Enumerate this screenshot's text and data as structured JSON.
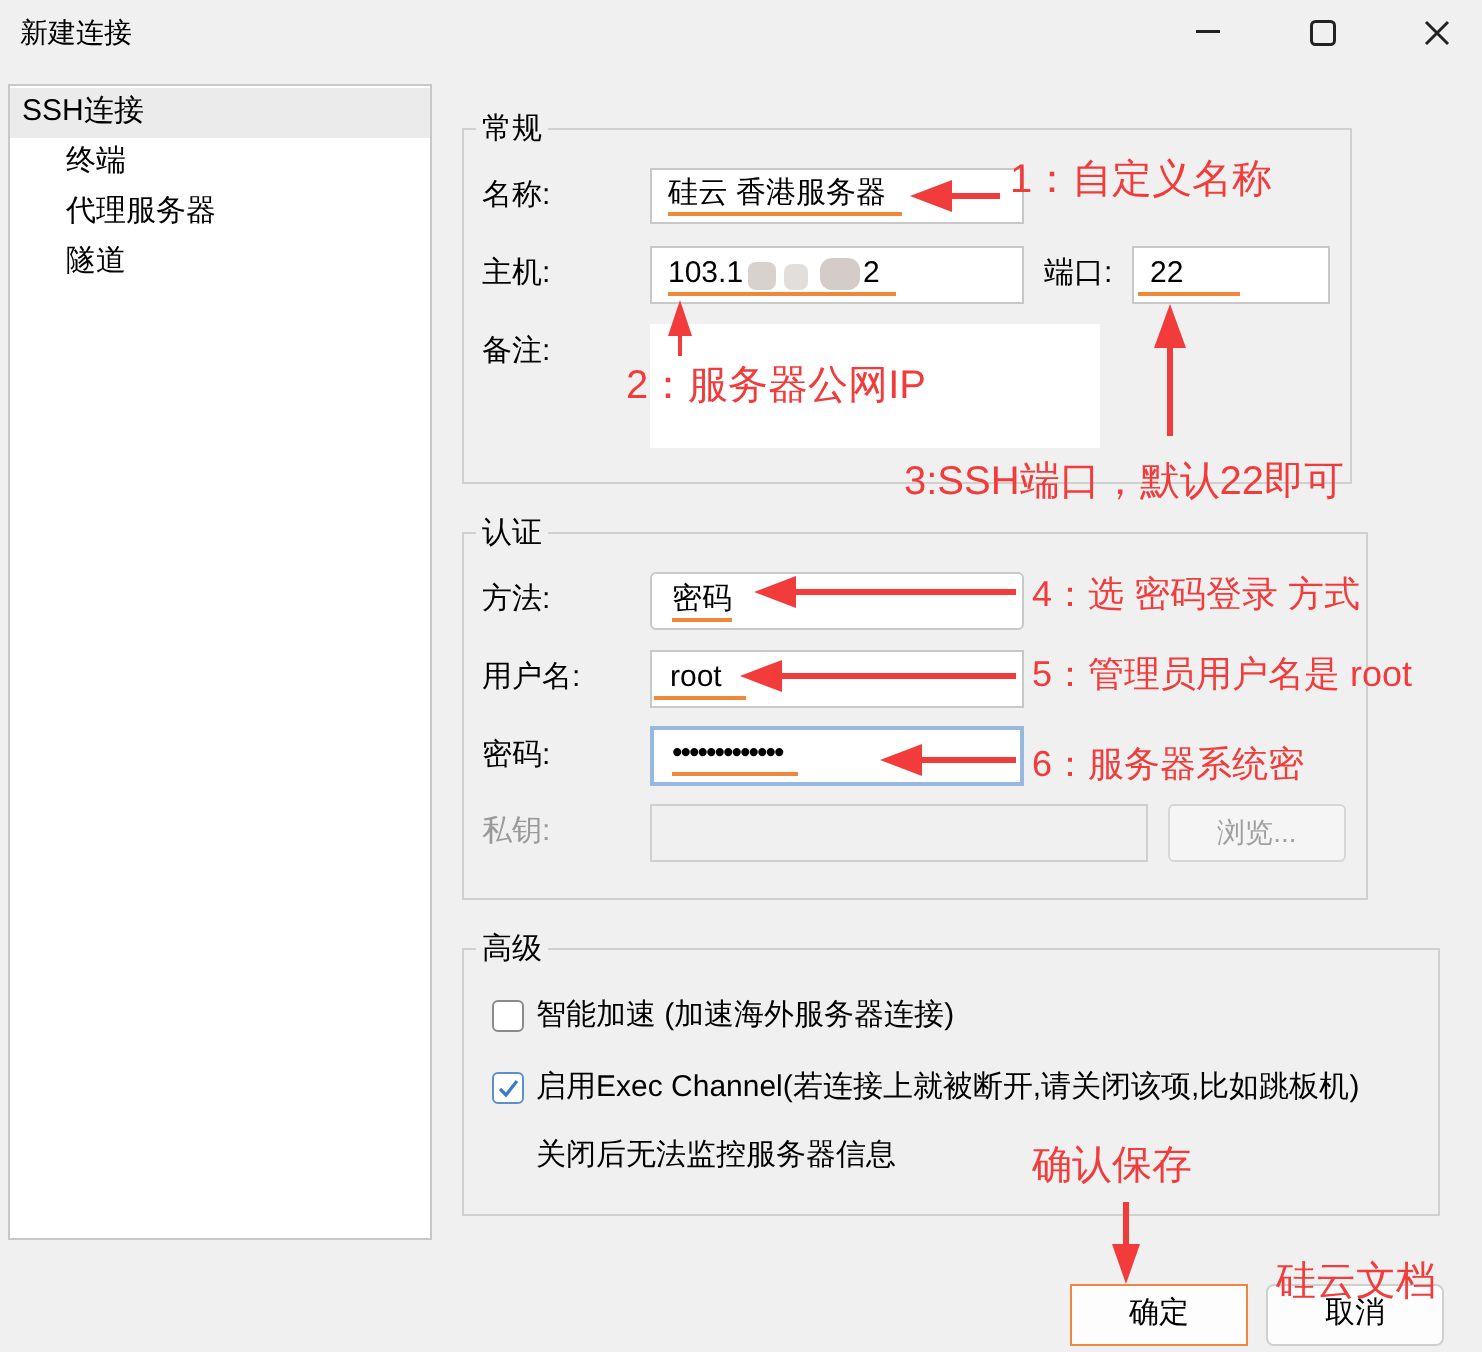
{
  "window": {
    "title": "新建连接"
  },
  "sidebar": {
    "items": [
      {
        "label": "SSH连接",
        "selected": true,
        "children": [
          {
            "label": "终端",
            "selected": false
          },
          {
            "label": "代理服务器",
            "selected": false
          },
          {
            "label": "隧道",
            "selected": false
          }
        ]
      }
    ]
  },
  "general": {
    "title": "常规",
    "name": {
      "label": "名称:",
      "value": "硅云 香港服务器"
    },
    "host": {
      "label": "主机:",
      "value_start": "103.1",
      "value_end": "2"
    },
    "port": {
      "label": "端口:",
      "value": "22"
    },
    "note": {
      "label": "备注:"
    }
  },
  "auth": {
    "title": "认证",
    "method": {
      "label": "方法:",
      "value": "密码"
    },
    "user": {
      "label": "用户名:",
      "value": "root"
    },
    "password": {
      "label": "密码:",
      "value": "•••••••••••••",
      "focused": true
    },
    "private_key": {
      "label": "私钥:",
      "disabled": true
    },
    "browse": {
      "label": "浏览...",
      "disabled": true
    }
  },
  "advanced": {
    "title": "高级",
    "options": [
      {
        "label": "智能加速 (加速海外服务器连接)",
        "checked": false
      },
      {
        "label": "启用Exec Channel(若连接上就被断开,请关闭该项,比如跳板机)",
        "checked": true
      }
    ],
    "note": "关闭后无法监控服务器信息"
  },
  "buttons": [
    {
      "label": "确定",
      "highlighted": true
    },
    {
      "label": "取消",
      "highlighted": false
    }
  ],
  "annotations": [
    {
      "text": "1：自定义名称"
    },
    {
      "text": "2：服务器公网IP"
    },
    {
      "text": "3:SSH端口，默认22即可"
    },
    {
      "text": "4：选 密码登录 方式"
    },
    {
      "text": "5：管理员用户名是 root"
    },
    {
      "text": "6：服务器系统密"
    },
    {
      "text": "确认保存"
    },
    {
      "text": "硅云文档"
    }
  ]
}
